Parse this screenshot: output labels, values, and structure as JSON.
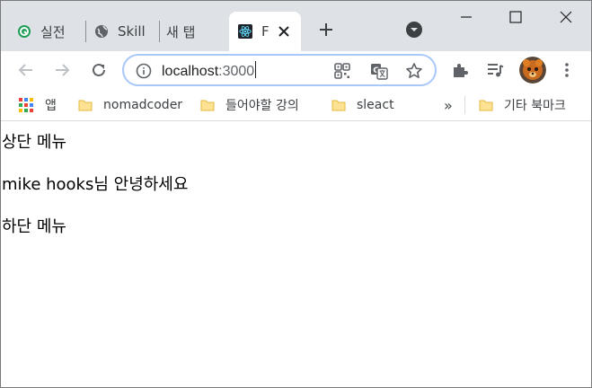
{
  "tabs": [
    {
      "label": "실전",
      "icon": "green-app-icon"
    },
    {
      "label": "Skill",
      "icon": "globe-icon"
    },
    {
      "label": "새 탭",
      "icon": ""
    },
    {
      "label": "F",
      "icon": "react-icon",
      "active": true
    }
  ],
  "toolbar": {
    "url_host": "localhost",
    "url_port": ":3000"
  },
  "bookmarks": {
    "apps_label": "앱",
    "items": [
      "nomadcoder",
      "들어야할 강의",
      "sleact"
    ],
    "overflow": "»",
    "other": "기타 북마크"
  },
  "content": {
    "header_menu": "상단 메뉴",
    "greeting": "mike hooks님 안녕하세요",
    "footer_menu": "하단 메뉴"
  },
  "colors": {
    "tabstrip": "#dee1e6",
    "omnibox_border": "#a8c7fa",
    "folder": "#f6cf63"
  }
}
